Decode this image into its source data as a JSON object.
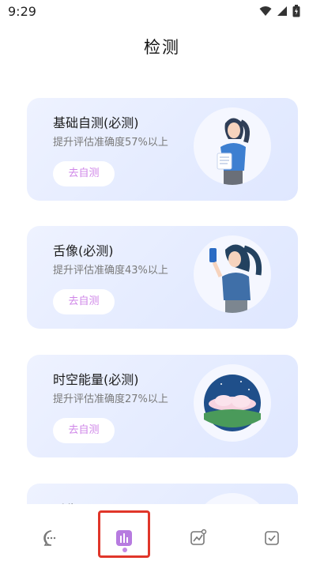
{
  "status_bar": {
    "time": "9:29"
  },
  "header": {
    "title": "检测"
  },
  "cards": [
    {
      "title": "基础自测(必测)",
      "subtitle": "提升评估准确度57%以上",
      "button": "去自测",
      "illustration": "woman-holding-paper"
    },
    {
      "title": "舌像(必测)",
      "subtitle": "提升评估准确度43%以上",
      "button": "去自测",
      "illustration": "woman-holding-phone"
    },
    {
      "title": "时空能量(必测)",
      "subtitle": "提升评估准确度27%以上",
      "button": "去自测",
      "illustration": "landscape-clouds"
    },
    {
      "title": "后像",
      "subtitle": "",
      "button": "",
      "illustration": "woman-portrait"
    }
  ],
  "bottom_nav": {
    "items": [
      {
        "name": "chat",
        "icon": "chat-bubble-icon"
      },
      {
        "name": "detect",
        "icon": "bar-chart-icon",
        "active": true
      },
      {
        "name": "trend",
        "icon": "trend-chart-icon"
      },
      {
        "name": "tasks",
        "icon": "checkbox-icon"
      }
    ],
    "accent_color": "#b77be0",
    "highlight_color": "#e0362a"
  }
}
